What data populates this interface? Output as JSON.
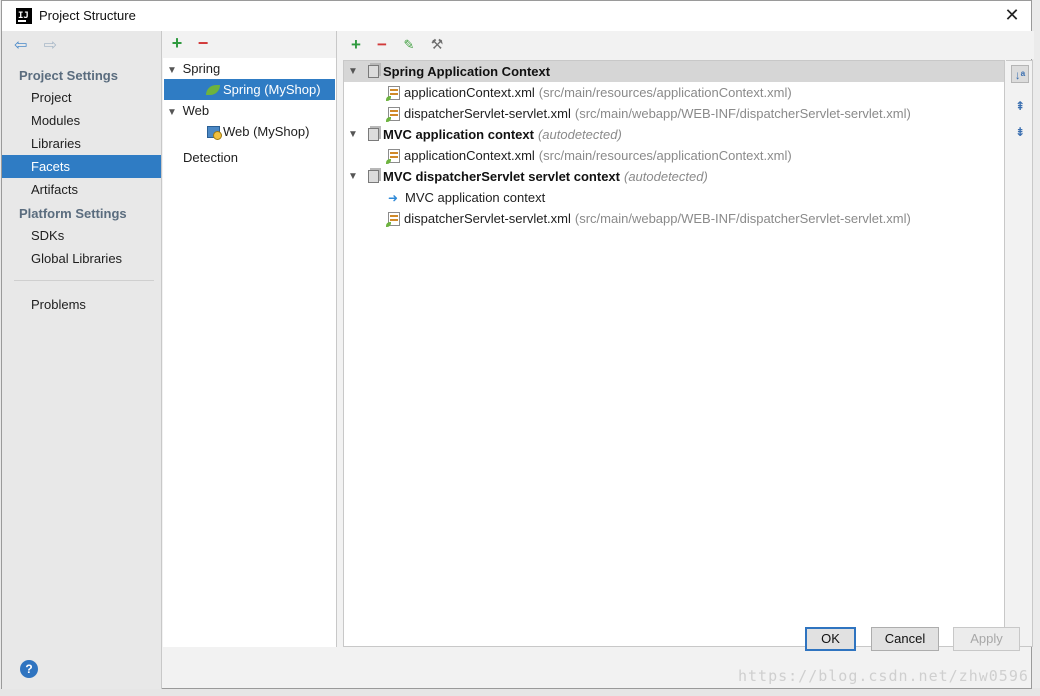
{
  "window": {
    "title": "Project Structure",
    "close_label": "✕"
  },
  "sidebar": {
    "groups": [
      {
        "label": "Project Settings",
        "items": [
          "Project",
          "Modules",
          "Libraries",
          "Facets",
          "Artifacts"
        ]
      },
      {
        "label": "Platform Settings",
        "items": [
          "SDKs",
          "Global Libraries"
        ]
      }
    ],
    "problems_label": "Problems",
    "selected": "Facets",
    "help_label": "?"
  },
  "facets": {
    "tree": [
      {
        "label": "Spring",
        "children": [
          "Spring (MyShop)"
        ]
      },
      {
        "label": "Web",
        "children": [
          "Web (MyShop)"
        ]
      },
      {
        "label": "Detection"
      }
    ],
    "selected": "Spring (MyShop)"
  },
  "contexts": [
    {
      "title": "Spring Application Context",
      "autodetected": "",
      "children": [
        {
          "file": "applicationContext.xml",
          "path": "(src/main/resources/applicationContext.xml)"
        },
        {
          "file": "dispatcherServlet-servlet.xml",
          "path": "(src/main/webapp/WEB-INF/dispatcherServlet-servlet.xml)"
        }
      ]
    },
    {
      "title": "MVC application context",
      "autodetected": "(autodetected)",
      "children": [
        {
          "file": "applicationContext.xml",
          "path": "(src/main/resources/applicationContext.xml)"
        }
      ]
    },
    {
      "title": "MVC dispatcherServlet servlet context",
      "autodetected": "(autodetected)",
      "children": [
        {
          "parent_context": "MVC application context"
        },
        {
          "file": "dispatcherServlet-servlet.xml",
          "path": "(src/main/webapp/WEB-INF/dispatcherServlet-servlet.xml)"
        }
      ]
    }
  ],
  "buttons": {
    "ok": "OK",
    "cancel": "Cancel",
    "apply": "Apply"
  },
  "watermark": "https://blog.csdn.net/zhw0596",
  "colors": {
    "selection": "#2f7cc4",
    "accent_green": "#2f9a3f",
    "accent_red": "#d23a3a"
  }
}
